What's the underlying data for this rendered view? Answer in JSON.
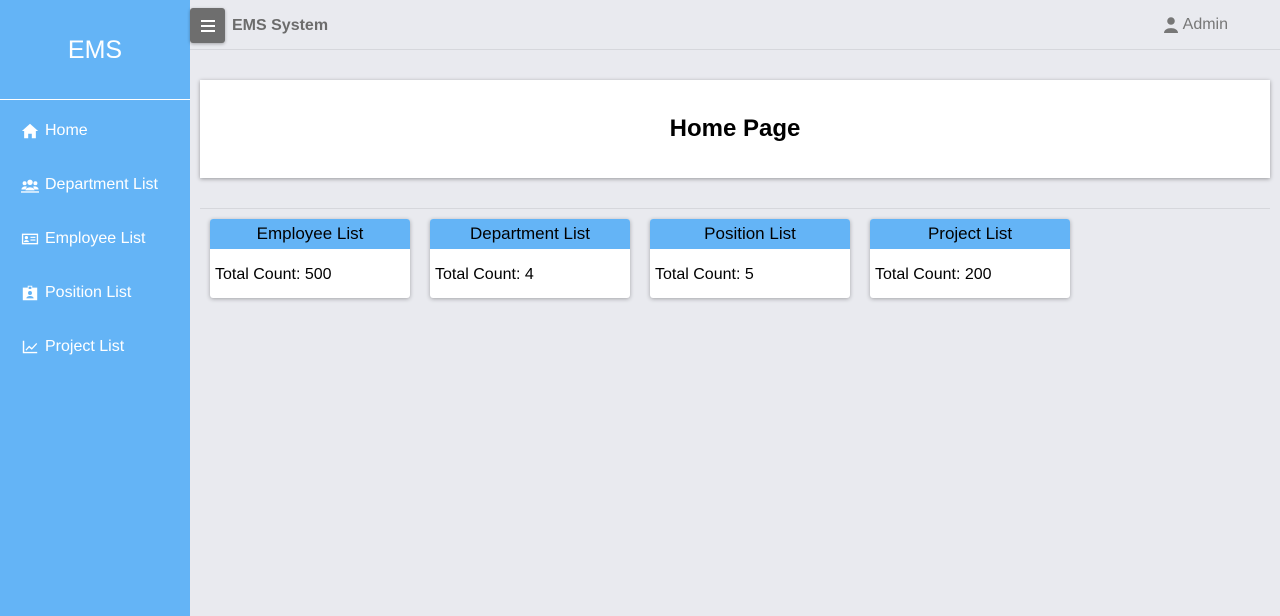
{
  "sidebar": {
    "brand": "EMS",
    "items": [
      {
        "label": "Home",
        "icon": "home-icon"
      },
      {
        "label": "Department List",
        "icon": "users-icon"
      },
      {
        "label": "Employee List",
        "icon": "id-card-icon"
      },
      {
        "label": "Position List",
        "icon": "id-badge-icon"
      },
      {
        "label": "Project List",
        "icon": "chart-line-icon"
      }
    ]
  },
  "topbar": {
    "menu_icon": "hamburger-icon",
    "title": "EMS System",
    "user_icon": "user-icon",
    "user_name": "Admin"
  },
  "main": {
    "page_title": "Home Page",
    "cards": [
      {
        "title": "Employee List",
        "count_text": "Total Count: 500"
      },
      {
        "title": "Department List",
        "count_text": "Total Count: 4"
      },
      {
        "title": "Position List",
        "count_text": "Total Count: 5"
      },
      {
        "title": "Project List",
        "count_text": "Total Count: 200"
      }
    ]
  },
  "colors": {
    "sidebar_bg": "#64b4f6",
    "page_bg": "#e9eaef",
    "card_header_bg": "#64b4f6",
    "menu_button_bg": "#6e6e6e"
  }
}
